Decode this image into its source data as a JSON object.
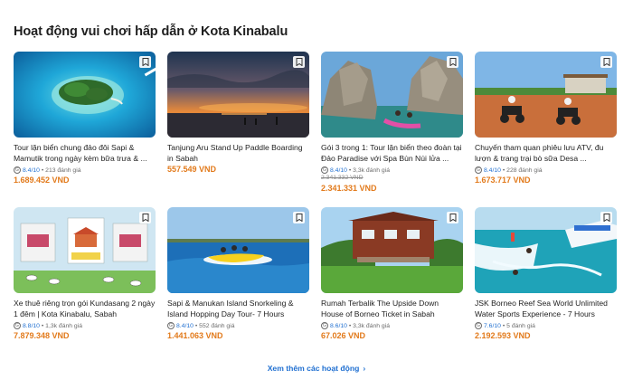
{
  "section": {
    "title": "Hoạt động vui chơi hấp dẫn ở Kota Kinabalu"
  },
  "cards": [
    {
      "title": "Tour lặn biển chung đảo đôi Sapi & Mamutik trong ngày kèm bữa trưa & ...",
      "score": "8.4/10",
      "reviews": "• 213 đánh giá",
      "old_price": "",
      "price": "1.689.452 VND"
    },
    {
      "title": "Tanjung Aru Stand Up Paddle Boarding in Sabah",
      "score": "",
      "reviews": "",
      "old_price": "",
      "price": "557.549 VND"
    },
    {
      "title": "Gói 3 trong 1: Tour lặn biển theo đoàn tại Đảo Paradise với Spa Bùn Núi lửa ...",
      "score": "8.4/10",
      "reviews": "• 3,3k đánh giá",
      "old_price": "2.341.332 VND",
      "price": "2.341.331 VND"
    },
    {
      "title": "Chuyến tham quan phiêu lưu ATV, đu lượn & trang trại bò sữa Desa ...",
      "score": "8.4/10",
      "reviews": "• 228 đánh giá",
      "old_price": "",
      "price": "1.673.717 VND"
    },
    {
      "title": "Xe thuê riêng trọn gói Kundasang 2 ngày 1 đêm | Kota Kinabalu, Sabah",
      "score": "8.8/10",
      "reviews": "• 1,3k đánh giá",
      "old_price": "",
      "price": "7.879.348 VND"
    },
    {
      "title": "Sapi & Manukan Island Snorkeling & Island Hopping Day Tour- 7 Hours",
      "score": "8.4/10",
      "reviews": "• 552 đánh giá",
      "old_price": "",
      "price": "1.441.063 VND"
    },
    {
      "title": "Rumah Terbalik The Upside Down House of Borneo Ticket in Sabah",
      "score": "8.6/10",
      "reviews": "• 3,3k đánh giá",
      "old_price": "",
      "price": "67.026 VND"
    },
    {
      "title": "JSK Borneo Reef Sea World Unlimited Water Sports Experience - 7 Hours",
      "score": "7.6/10",
      "reviews": "• 5 đánh giá",
      "old_price": "",
      "price": "2.192.593 VND"
    }
  ],
  "see_more": {
    "label": "Xem thêm các hoạt động"
  },
  "colors": {
    "price": "#e27a1b",
    "link": "#1f6fd1",
    "score": "#1f6fd1"
  },
  "icons": {
    "bookmark": "bookmark-icon",
    "more": "chevron-right-icon",
    "rating": "google-icon"
  }
}
